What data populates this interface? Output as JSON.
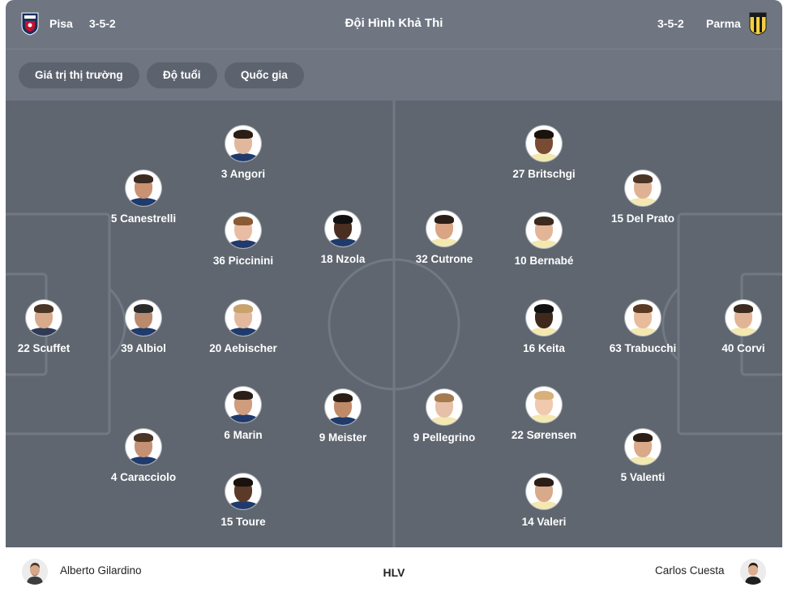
{
  "header": {
    "home_team": "Pisa",
    "home_formation": "3-5-2",
    "title": "Đội Hình Khả Thi",
    "away_formation": "3-5-2",
    "away_team": "Parma",
    "home_logo_icon": "pisa-crest-icon",
    "away_logo_icon": "parma-crest-icon"
  },
  "filters": [
    {
      "label": "Giá trị thị trường"
    },
    {
      "label": "Độ tuổi"
    },
    {
      "label": "Quốc gia"
    }
  ],
  "colors": {
    "header_bg": "#6f7682",
    "chip_bg": "#5c636e",
    "pitch_bg": "#5f6670",
    "pitch_lines": "#737a85"
  },
  "home_players": [
    {
      "label": "22 Scuffet",
      "skin": "#d8a98a",
      "hair": "#4a3526",
      "shirt": "#2f3b55"
    },
    {
      "label": "5 Canestrelli",
      "skin": "#c99272",
      "hair": "#3b2a1f",
      "shirt": "#1f3a6b"
    },
    {
      "label": "39 Albiol",
      "skin": "#b98a6d",
      "hair": "#2b2b2b",
      "shirt": "#1f3a6b"
    },
    {
      "label": "4 Caracciolo",
      "skin": "#c49174",
      "hair": "#4a3526",
      "shirt": "#1f3a6b"
    },
    {
      "label": "3 Angori",
      "skin": "#e2b89c",
      "hair": "#2b1e16",
      "shirt": "#1f3a6b"
    },
    {
      "label": "36 Piccinini",
      "skin": "#e8bda3",
      "hair": "#8a5a34",
      "shirt": "#1f3a6b"
    },
    {
      "label": "20 Aebischer",
      "skin": "#e4b89d",
      "hair": "#c9a36e",
      "shirt": "#1f3a6b"
    },
    {
      "label": "6 Marin",
      "skin": "#cf9c7d",
      "hair": "#2b1e16",
      "shirt": "#1f3a6b"
    },
    {
      "label": "15 Toure",
      "skin": "#5b3a28",
      "hair": "#1a120d",
      "shirt": "#1f3a6b"
    },
    {
      "label": "18 Nzola",
      "skin": "#4a2e20",
      "hair": "#111111",
      "shirt": "#1f3a6b"
    },
    {
      "label": "9 Meister",
      "skin": "#c08a68",
      "hair": "#2b1e16",
      "shirt": "#1f3a6b"
    }
  ],
  "away_players": [
    {
      "label": "32 Cutrone",
      "skin": "#d9a585",
      "hair": "#2b1e16",
      "shirt": "#f2e8b0"
    },
    {
      "label": "9 Pellegrino",
      "skin": "#e6c0a8",
      "hair": "#a57a4e",
      "shirt": "#f2e8b0"
    },
    {
      "label": "27 Britschgi",
      "skin": "#7a4b33",
      "hair": "#1a120d",
      "shirt": "#f2e8b0"
    },
    {
      "label": "10 Bernabé",
      "skin": "#e3b597",
      "hair": "#3b2a1f",
      "shirt": "#f2e8b0"
    },
    {
      "label": "16 Keita",
      "skin": "#3f281c",
      "hair": "#111111",
      "shirt": "#f2e8b0"
    },
    {
      "label": "22 Sørensen",
      "skin": "#f0c9ae",
      "hair": "#d9b07a",
      "shirt": "#f2e8b0"
    },
    {
      "label": "14 Valeri",
      "skin": "#d8a98a",
      "hair": "#2b1e16",
      "shirt": "#f2e8b0"
    },
    {
      "label": "15 Del Prato",
      "skin": "#e0b294",
      "hair": "#4a3526",
      "shirt": "#f2e8b0"
    },
    {
      "label": "63 Trabucchi",
      "skin": "#e7bb9c",
      "hair": "#5a3a22",
      "shirt": "#f2e8b0"
    },
    {
      "label": "5 Valenti",
      "skin": "#d9a98a",
      "hair": "#2b1e16",
      "shirt": "#f2e8b0"
    },
    {
      "label": "40 Corvi",
      "skin": "#e2b496",
      "hair": "#3b2a1f",
      "shirt": "#f2e8b0"
    }
  ],
  "coaches": {
    "home": "Alberto Gilardino",
    "label": "HLV",
    "away": "Carlos Cuesta"
  }
}
